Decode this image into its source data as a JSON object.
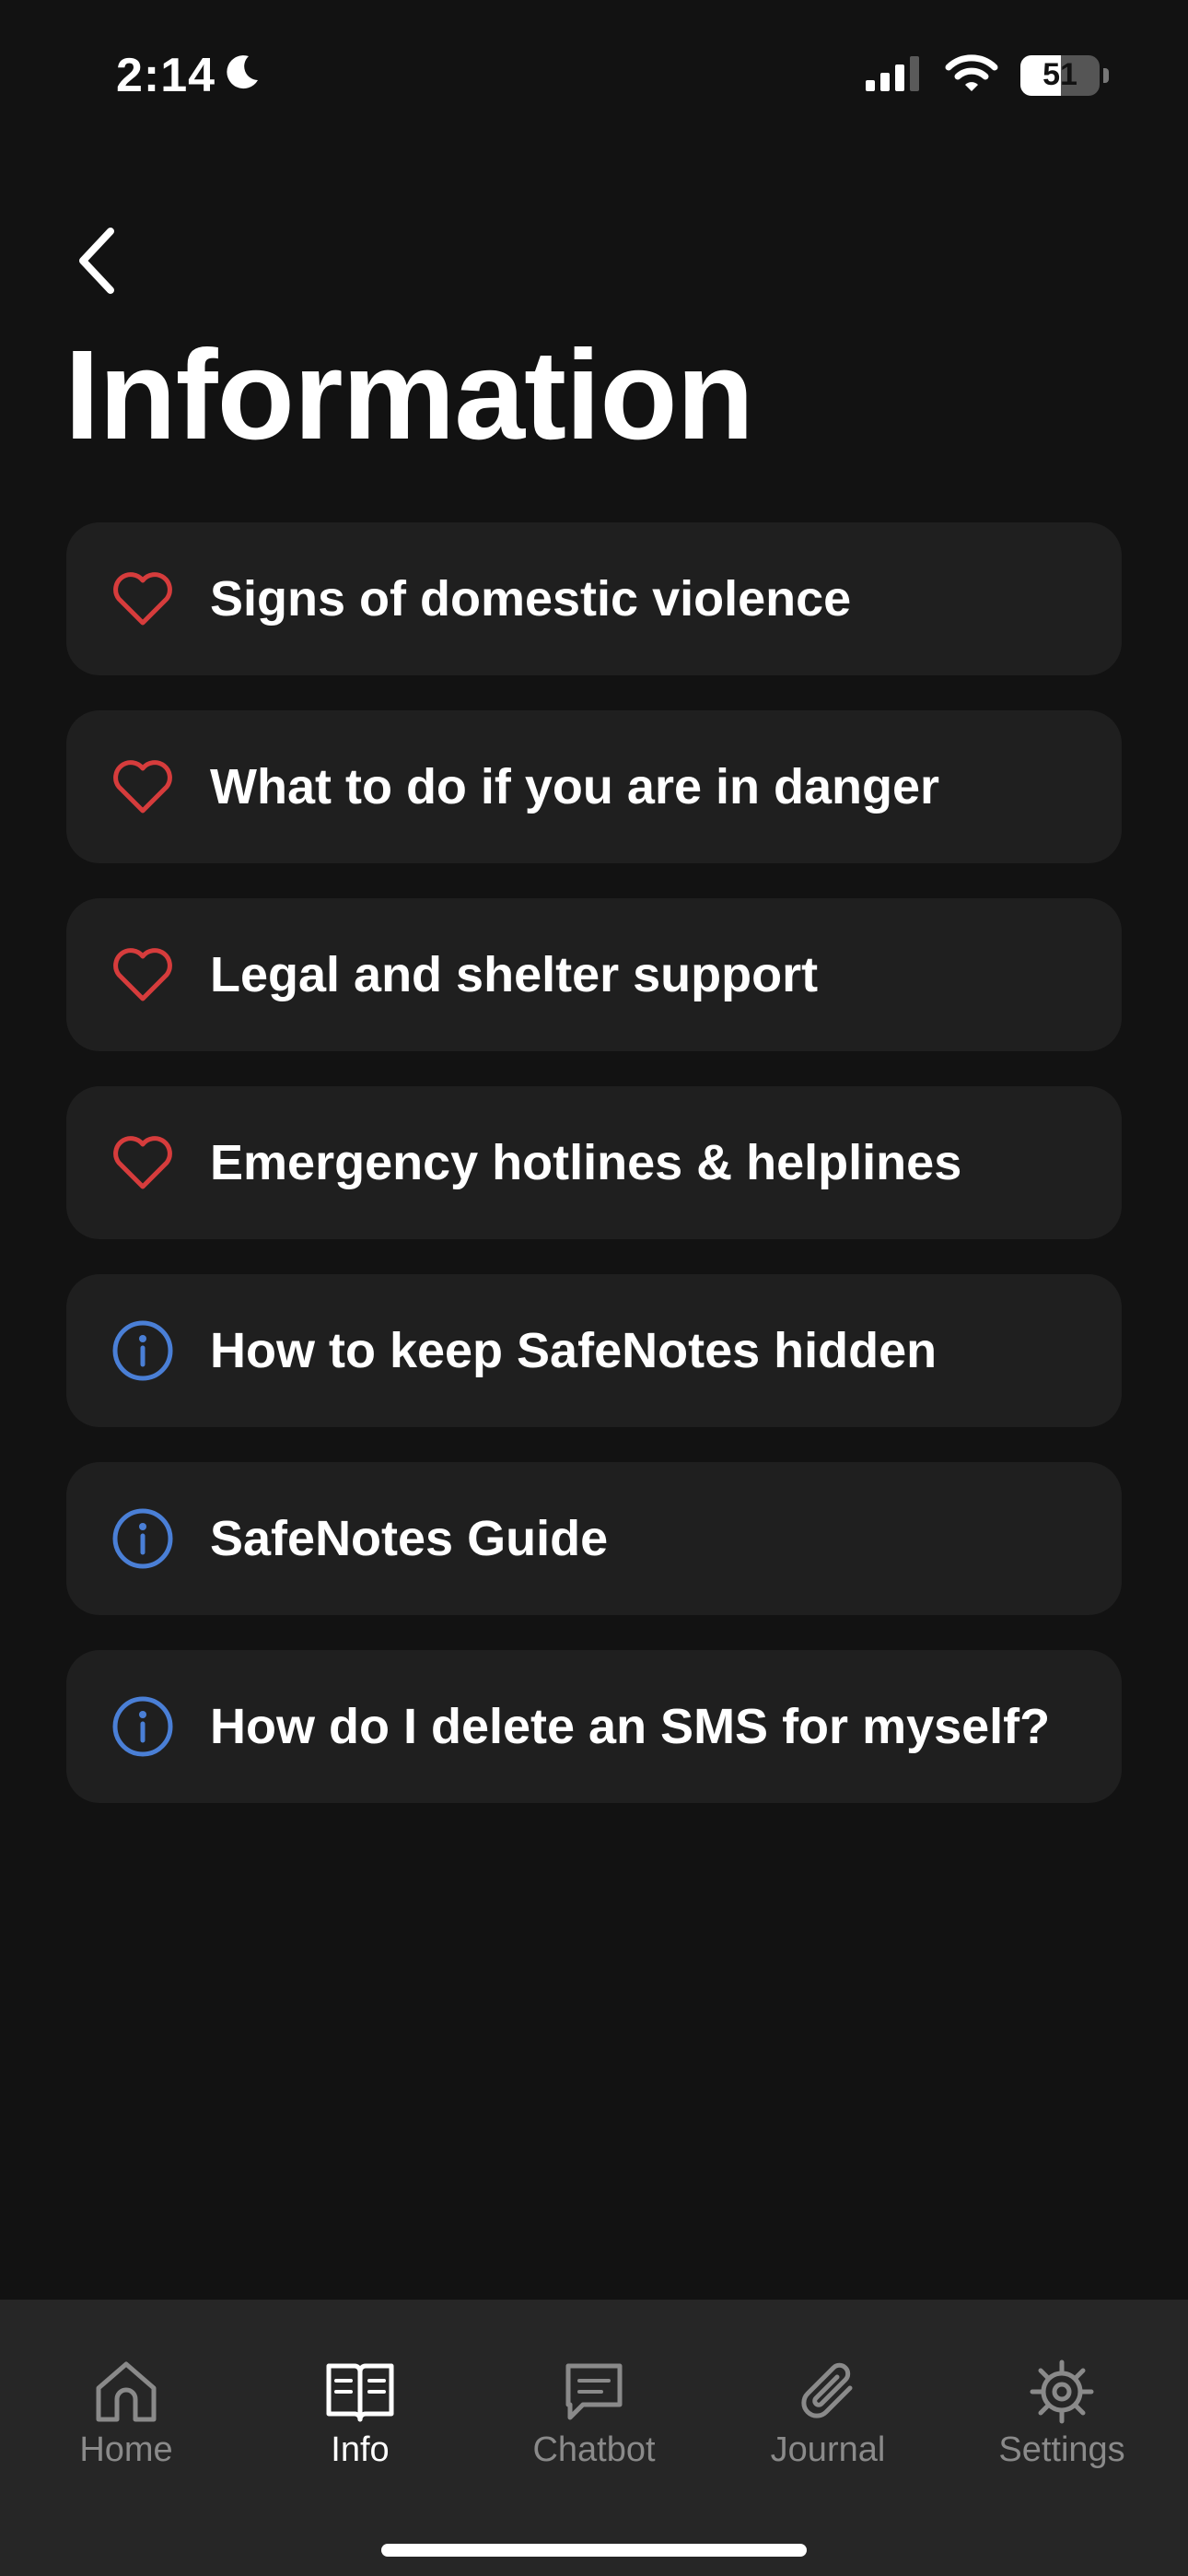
{
  "status_bar": {
    "time": "2:14",
    "battery_level": "51",
    "battery_fraction": 0.51,
    "icons": [
      "moon-icon",
      "signal-icon",
      "wifi-icon",
      "battery-icon"
    ]
  },
  "header": {
    "back_icon": "chevron-left-icon",
    "title": "Information"
  },
  "items": [
    {
      "label": "Signs of domestic violence",
      "icon": "heart-icon"
    },
    {
      "label": "What to do if you are in danger",
      "icon": "heart-icon"
    },
    {
      "label": "Legal and shelter support",
      "icon": "heart-icon"
    },
    {
      "label": "Emergency hotlines & helplines",
      "icon": "heart-icon"
    },
    {
      "label": "How to keep SafeNotes hidden",
      "icon": "info-icon"
    },
    {
      "label": "SafeNotes Guide",
      "icon": "info-icon"
    },
    {
      "label": "How do I delete an SMS for myself?",
      "icon": "info-icon"
    }
  ],
  "tab_bar": {
    "active": "Info",
    "tabs": [
      {
        "label": "Home",
        "icon": "home-icon"
      },
      {
        "label": "Info",
        "icon": "book-icon"
      },
      {
        "label": "Chatbot",
        "icon": "chat-icon"
      },
      {
        "label": "Journal",
        "icon": "paperclip-icon"
      },
      {
        "label": "Settings",
        "icon": "gear-icon"
      }
    ]
  },
  "colors": {
    "background": "#121212",
    "card": "#1f1f1f",
    "tab_bar": "#262626",
    "heart_accent": "#d63c3c",
    "info_accent": "#4a7fd6",
    "inactive_tab": "#8a8a8a",
    "text": "#ffffff"
  }
}
